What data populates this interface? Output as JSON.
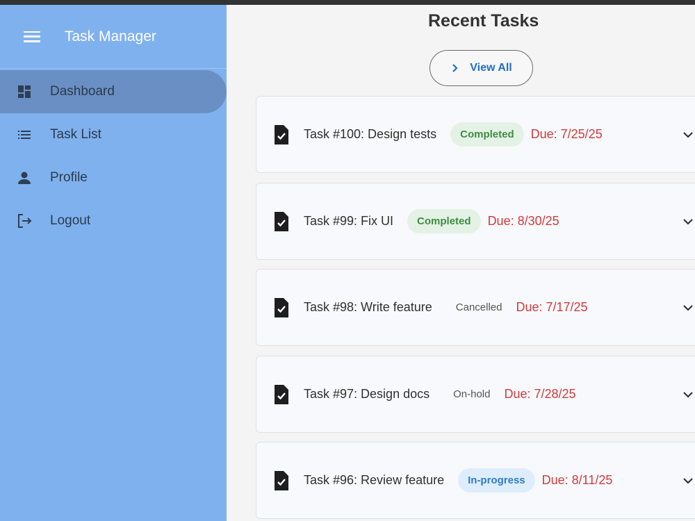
{
  "app": {
    "title": "Task Manager"
  },
  "sidebar": {
    "items": [
      {
        "label": "Dashboard",
        "icon": "dashboard-icon",
        "active": true
      },
      {
        "label": "Task List",
        "icon": "list-icon",
        "active": false
      },
      {
        "label": "Profile",
        "icon": "person-icon",
        "active": false
      },
      {
        "label": "Logout",
        "icon": "logout-icon",
        "active": false
      }
    ]
  },
  "main": {
    "title": "Recent Tasks",
    "view_all_label": "View All",
    "tasks": [
      {
        "title": "Task #100: Design tests",
        "status": "Completed",
        "due": "Due: 7/25/25"
      },
      {
        "title": "Task #99: Fix UI",
        "status": "Completed",
        "due": "Due: 8/30/25"
      },
      {
        "title": "Task #98: Write feature",
        "status": "Cancelled",
        "due": "Due: 7/17/25"
      },
      {
        "title": "Task #97: Design docs",
        "status": "On-hold",
        "due": "Due: 7/28/25"
      },
      {
        "title": "Task #96: Review feature",
        "status": "In-progress",
        "due": "Due: 8/11/25"
      }
    ]
  },
  "colors": {
    "sidebar_bg": "#7fb1ee",
    "active_item_bg": "#6a8fc4",
    "accent_blue": "#1f6ec8",
    "due_red": "#d13a3a",
    "completed_green": "#3f8c43"
  }
}
